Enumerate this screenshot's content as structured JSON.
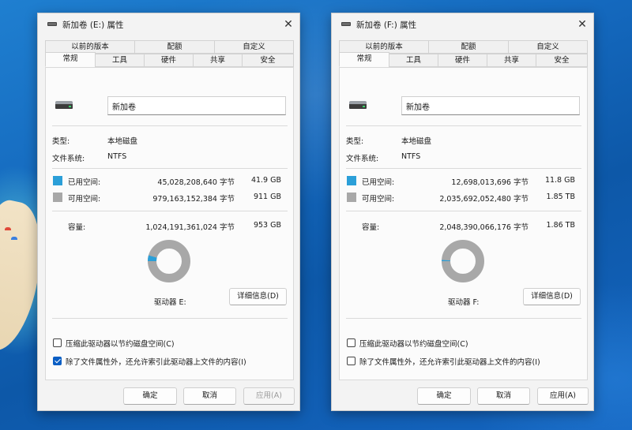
{
  "desktop": {
    "colors": {
      "ocean": "#1468bd",
      "beach": "#f2e3c6",
      "shallow": "#5cc8d8"
    }
  },
  "dialogs": [
    {
      "id": "e",
      "title": "新加卷 (E:) 属性",
      "close_glyph": "✕",
      "tabs_top": [
        "以前的版本",
        "配额",
        "自定义"
      ],
      "tabs_bottom": [
        "常规",
        "工具",
        "硬件",
        "共享",
        "安全"
      ],
      "active_tab": "常规",
      "drive_icon": "drive-icon",
      "volume_name": "新加卷",
      "type_label": "类型:",
      "type_value": "本地磁盘",
      "fs_label": "文件系统:",
      "fs_value": "NTFS",
      "used": {
        "label": "已用空间:",
        "bytes": "45,028,208,640 字节",
        "size": "41.9 GB",
        "color": "#2b9fd8"
      },
      "free": {
        "label": "可用空间:",
        "bytes": "979,163,152,384 字节",
        "size": "911 GB",
        "color": "#a8a8a8"
      },
      "capacity": {
        "label": "容量:",
        "bytes": "1,024,191,361,024 字节",
        "size": "953 GB"
      },
      "used_fraction": 0.044,
      "drive_label": "驱动器 E:",
      "details_button": "详细信息(D)",
      "compress": {
        "label": "压缩此驱动器以节约磁盘空间(C)",
        "checked": false
      },
      "index": {
        "label": "除了文件属性外，还允许索引此驱动器上文件的内容(I)",
        "checked": true
      },
      "buttons": {
        "ok": "确定",
        "cancel": "取消",
        "apply": "应用(A)",
        "apply_enabled": false
      }
    },
    {
      "id": "f",
      "title": "新加卷 (F:) 属性",
      "close_glyph": "✕",
      "tabs_top": [
        "以前的版本",
        "配额",
        "自定义"
      ],
      "tabs_bottom": [
        "常规",
        "工具",
        "硬件",
        "共享",
        "安全"
      ],
      "active_tab": "常规",
      "drive_icon": "drive-icon",
      "volume_name": "新加卷",
      "type_label": "类型:",
      "type_value": "本地磁盘",
      "fs_label": "文件系统:",
      "fs_value": "NTFS",
      "used": {
        "label": "已用空间:",
        "bytes": "12,698,013,696 字节",
        "size": "11.8 GB",
        "color": "#2b9fd8"
      },
      "free": {
        "label": "可用空间:",
        "bytes": "2,035,692,052,480 字节",
        "size": "1.85 TB",
        "color": "#a8a8a8"
      },
      "capacity": {
        "label": "容量:",
        "bytes": "2,048,390,066,176 字节",
        "size": "1.86 TB"
      },
      "used_fraction": 0.006,
      "drive_label": "驱动器 F:",
      "details_button": "详细信息(D)",
      "compress": {
        "label": "压缩此驱动器以节约磁盘空间(C)",
        "checked": false
      },
      "index": {
        "label": "除了文件属性外，还允许索引此驱动器上文件的内容(I)",
        "checked": false
      },
      "buttons": {
        "ok": "确定",
        "cancel": "取消",
        "apply": "应用(A)",
        "apply_enabled": true
      }
    }
  ]
}
